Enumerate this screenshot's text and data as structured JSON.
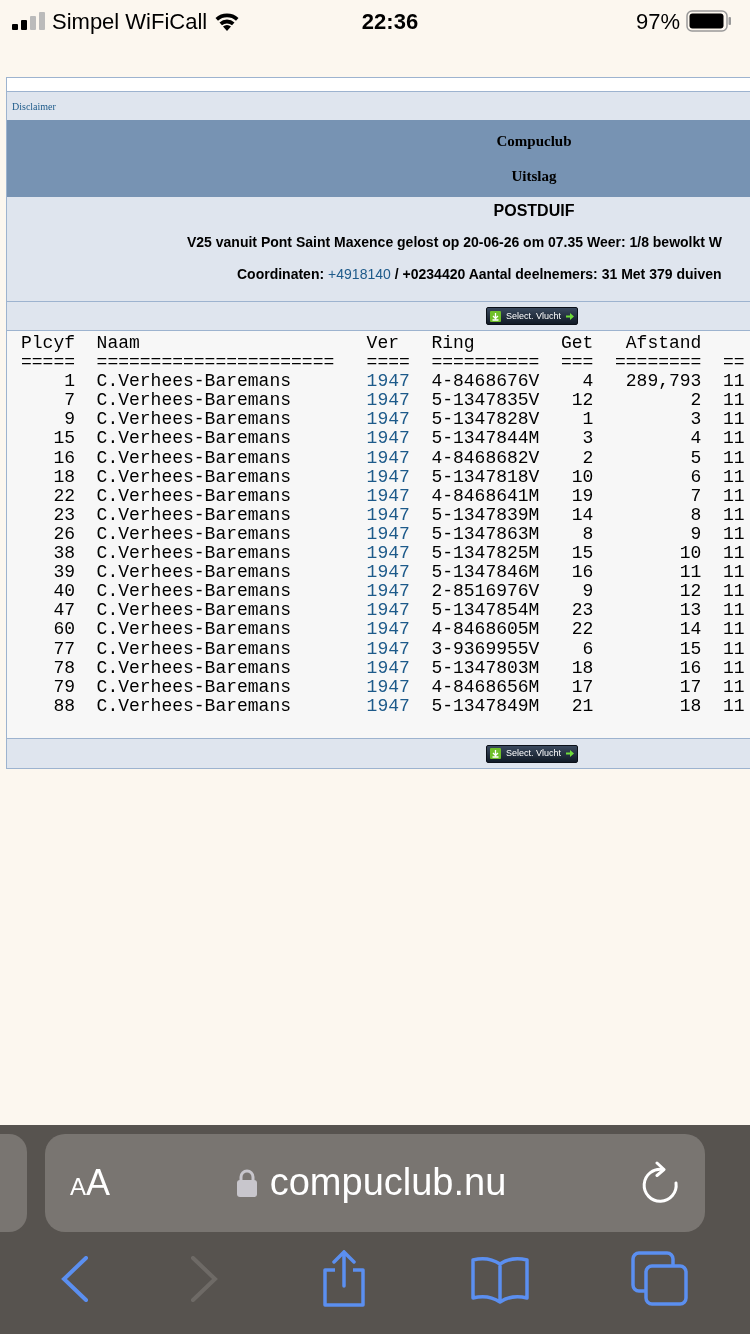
{
  "status_bar": {
    "carrier": "Simpel WiFiCall",
    "time": "22:36",
    "battery": "97%"
  },
  "page": {
    "disclaimer": "Disclaimer",
    "header": {
      "club": "Compuclub",
      "subtitle": "Uitslag"
    },
    "info": {
      "title": "POSTDUIF",
      "race_line": "V25 vanuit Pont Saint Maxence gelost op 20-06-26 om 07.35 Weer: 1/8 bewolkt W",
      "coord_label": "Coordinaten:",
      "coord_link": "+4918140",
      "coord_rest": "/ +0234420 Aantal deelnemers: 31 Met 379 duiven"
    },
    "top_button": "Select. Vlucht",
    "table": {
      "columns": [
        "Plcyf",
        "Naam",
        "Ver",
        "Ring",
        "Get",
        "Afstand"
      ],
      "separators": [
        "=====",
        "======================",
        "====",
        "==========",
        "===",
        "========",
        "=="
      ],
      "rows": [
        [
          "1",
          "C.Verhees-Baremans",
          "1947",
          "4-8468676V",
          "4",
          "289,793",
          "11"
        ],
        [
          "7",
          "C.Verhees-Baremans",
          "1947",
          "5-1347835V",
          "12",
          "2",
          "11"
        ],
        [
          "9",
          "C.Verhees-Baremans",
          "1947",
          "5-1347828V",
          "1",
          "3",
          "11"
        ],
        [
          "15",
          "C.Verhees-Baremans",
          "1947",
          "5-1347844M",
          "3",
          "4",
          "11"
        ],
        [
          "16",
          "C.Verhees-Baremans",
          "1947",
          "4-8468682V",
          "2",
          "5",
          "11"
        ],
        [
          "18",
          "C.Verhees-Baremans",
          "1947",
          "5-1347818V",
          "10",
          "6",
          "11"
        ],
        [
          "22",
          "C.Verhees-Baremans",
          "1947",
          "4-8468641M",
          "19",
          "7",
          "11"
        ],
        [
          "23",
          "C.Verhees-Baremans",
          "1947",
          "5-1347839M",
          "14",
          "8",
          "11"
        ],
        [
          "26",
          "C.Verhees-Baremans",
          "1947",
          "5-1347863M",
          "8",
          "9",
          "11"
        ],
        [
          "38",
          "C.Verhees-Baremans",
          "1947",
          "5-1347825M",
          "15",
          "10",
          "11"
        ],
        [
          "39",
          "C.Verhees-Baremans",
          "1947",
          "5-1347846M",
          "16",
          "11",
          "11"
        ],
        [
          "40",
          "C.Verhees-Baremans",
          "1947",
          "2-8516976V",
          "9",
          "12",
          "11"
        ],
        [
          "47",
          "C.Verhees-Baremans",
          "1947",
          "5-1347854M",
          "23",
          "13",
          "11"
        ],
        [
          "60",
          "C.Verhees-Baremans",
          "1947",
          "4-8468605M",
          "22",
          "14",
          "11"
        ],
        [
          "77",
          "C.Verhees-Baremans",
          "1947",
          "3-9369955V",
          "6",
          "15",
          "11"
        ],
        [
          "78",
          "C.Verhees-Baremans",
          "1947",
          "5-1347803M",
          "18",
          "16",
          "11"
        ],
        [
          "79",
          "C.Verhees-Baremans",
          "1947",
          "4-8468656M",
          "17",
          "17",
          "11"
        ],
        [
          "88",
          "C.Verhees-Baremans",
          "1947",
          "5-1347849M",
          "21",
          "18",
          "11"
        ]
      ]
    },
    "bottom_button": "Select. Vlucht"
  },
  "browser": {
    "text_size": [
      "A",
      "A"
    ],
    "url": "compuclub.nu"
  }
}
